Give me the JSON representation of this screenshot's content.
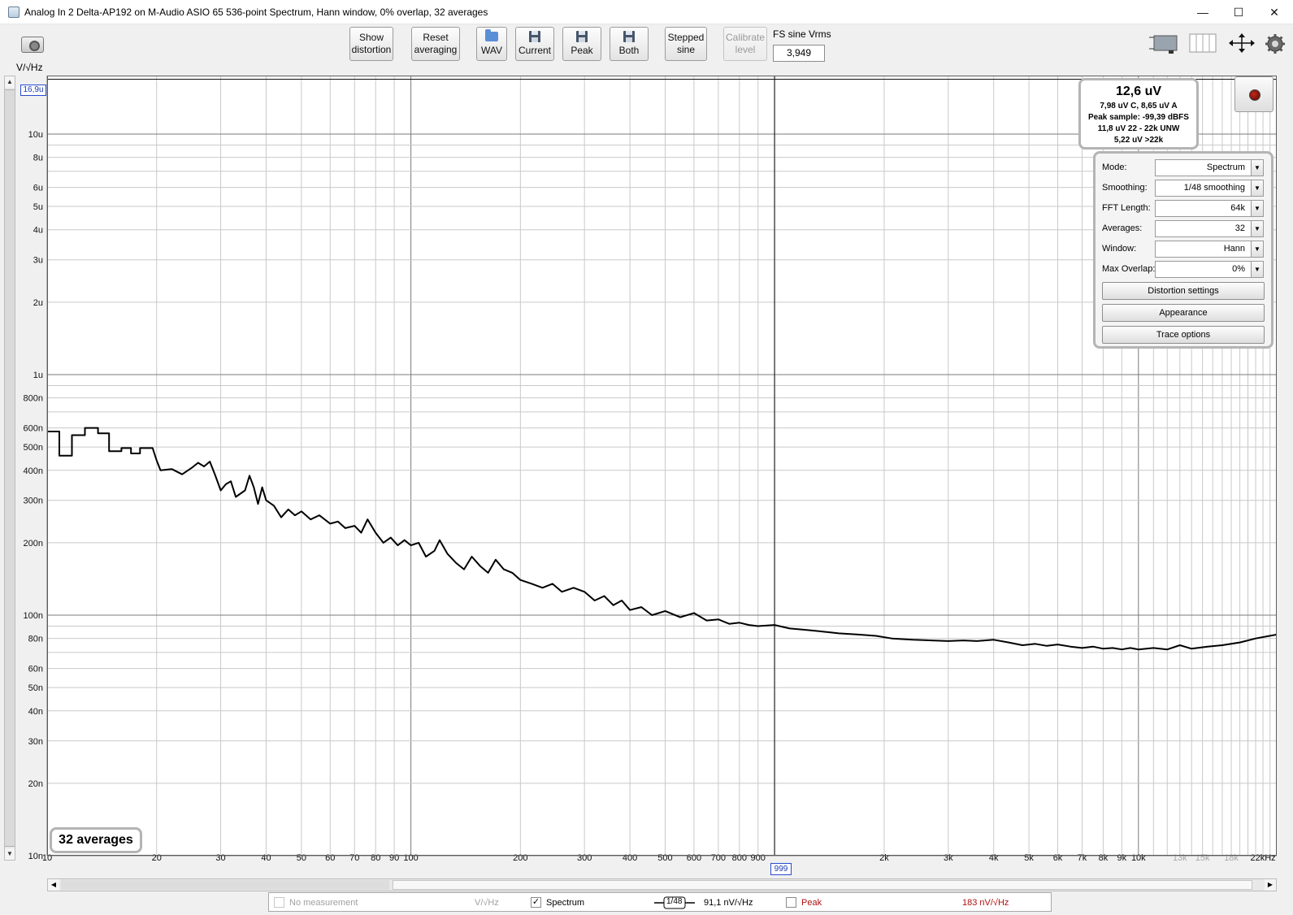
{
  "window": {
    "title": "Analog In 2 Delta-AP192 on M-Audio ASIO 65 536-point Spectrum, Hann window, 0% overlap, 32 averages",
    "minimize_glyph": "—",
    "maximize_glyph": "☐",
    "close_glyph": "✕"
  },
  "toolbar": {
    "show_distortion": [
      "Show",
      "distortion"
    ],
    "reset_averaging": [
      "Reset",
      "averaging"
    ],
    "wav": "WAV",
    "current": "Current",
    "peak": "Peak",
    "both": "Both",
    "stepped_sine": [
      "Stepped",
      "sine"
    ],
    "calibrate_level": [
      "Calibrate",
      "level"
    ],
    "fs_sine_label": "FS sine Vrms",
    "fs_sine_value": "3,949"
  },
  "y_unit_label": "V/√Hz",
  "y_marker": "16,9u",
  "x_marker": "999",
  "averages_badge": "32 averages",
  "info": {
    "main": "12,6 uV",
    "line1": "7,98 uV C, 8,65 uV A",
    "line2": "Peak sample: -99,39 dBFS",
    "line3": "11,8 uV 22 - 22k UNW",
    "line4": "5,22 uV >22k"
  },
  "controls": {
    "mode": {
      "label": "Mode:",
      "value": "Spectrum"
    },
    "smoothing": {
      "label": "Smoothing:",
      "value": "1/48 smoothing"
    },
    "fft_length": {
      "label": "FFT Length:",
      "value": "64k"
    },
    "averages": {
      "label": "Averages:",
      "value": "32"
    },
    "window": {
      "label": "Window:",
      "value": "Hann"
    },
    "max_overlap": {
      "label": "Max Overlap:",
      "value": "0%"
    },
    "distortion_settings": "Distortion settings",
    "appearance": "Appearance",
    "trace_options": "Trace options"
  },
  "legend": {
    "no_measurement": "No measurement",
    "no_measurement_unit": "V/√Hz",
    "spectrum": "Spectrum",
    "spectrum_smoothing": "1/48",
    "spectrum_value": "91,1 nV/√Hz",
    "peak": "Peak",
    "peak_value": "183 nV/√Hz",
    "spectrum_checked_glyph": "✓"
  },
  "icons": {
    "camera": "camera-icon",
    "graph_layout": "graph-layout-icon",
    "columns": "columns-icon",
    "move": "move-arrows-icon",
    "settings": "gear-icon",
    "record": "record-icon"
  },
  "chart_data": {
    "type": "line",
    "xlabel": "",
    "ylabel": "V/√Hz",
    "xscale": "log",
    "yscale": "log",
    "xlim": [
      10,
      24000
    ],
    "ylim": [
      1e-08,
      1.75e-05
    ],
    "x_ticks": [
      {
        "v": 10,
        "label": "10"
      },
      {
        "v": 20,
        "label": "20"
      },
      {
        "v": 30,
        "label": "30"
      },
      {
        "v": 40,
        "label": "40"
      },
      {
        "v": 50,
        "label": "50"
      },
      {
        "v": 60,
        "label": "60"
      },
      {
        "v": 70,
        "label": "70"
      },
      {
        "v": 80,
        "label": "80"
      },
      {
        "v": 90,
        "label": "90"
      },
      {
        "v": 100,
        "label": "100"
      },
      {
        "v": 200,
        "label": "200"
      },
      {
        "v": 300,
        "label": "300"
      },
      {
        "v": 400,
        "label": "400"
      },
      {
        "v": 500,
        "label": "500"
      },
      {
        "v": 600,
        "label": "600"
      },
      {
        "v": 700,
        "label": "700"
      },
      {
        "v": 800,
        "label": "800"
      },
      {
        "v": 900,
        "label": "900"
      },
      {
        "v": 2000,
        "label": "2k"
      },
      {
        "v": 3000,
        "label": "3k"
      },
      {
        "v": 4000,
        "label": "4k"
      },
      {
        "v": 5000,
        "label": "5k"
      },
      {
        "v": 6000,
        "label": "6k"
      },
      {
        "v": 7000,
        "label": "7k"
      },
      {
        "v": 8000,
        "label": "8k"
      },
      {
        "v": 9000,
        "label": "9k"
      },
      {
        "v": 10000,
        "label": "10k"
      },
      {
        "v": 13000,
        "label": "13k",
        "dim": true
      },
      {
        "v": 15000,
        "label": "15k",
        "dim": true
      },
      {
        "v": 18000,
        "label": "18k",
        "dim": true
      },
      {
        "v": 22000,
        "label": "22kHz"
      }
    ],
    "y_ticks": [
      {
        "v": 1e-05,
        "label": "10u"
      },
      {
        "v": 8e-06,
        "label": "8u"
      },
      {
        "v": 6e-06,
        "label": "6u"
      },
      {
        "v": 5e-06,
        "label": "5u"
      },
      {
        "v": 4e-06,
        "label": "4u"
      },
      {
        "v": 3e-06,
        "label": "3u"
      },
      {
        "v": 2e-06,
        "label": "2u"
      },
      {
        "v": 1e-06,
        "label": "1u"
      },
      {
        "v": 8e-07,
        "label": "800n"
      },
      {
        "v": 6e-07,
        "label": "600n"
      },
      {
        "v": 5e-07,
        "label": "500n"
      },
      {
        "v": 4e-07,
        "label": "400n"
      },
      {
        "v": 3e-07,
        "label": "300n"
      },
      {
        "v": 2e-07,
        "label": "200n"
      },
      {
        "v": 1e-07,
        "label": "100n"
      },
      {
        "v": 8e-08,
        "label": "80n"
      },
      {
        "v": 6e-08,
        "label": "60n"
      },
      {
        "v": 5e-08,
        "label": "50n"
      },
      {
        "v": 4e-08,
        "label": "40n"
      },
      {
        "v": 3e-08,
        "label": "30n"
      },
      {
        "v": 2e-08,
        "label": "20n"
      },
      {
        "v": 1e-08,
        "label": "10n"
      }
    ],
    "cursor": {
      "x": 999,
      "y": 1.69e-05
    },
    "series": [
      {
        "color": "#000000",
        "points": [
          [
            10,
            5.8e-07
          ],
          [
            10.8,
            5.8e-07
          ],
          [
            10.8,
            4.6e-07
          ],
          [
            11.7,
            4.6e-07
          ],
          [
            11.7,
            5.6e-07
          ],
          [
            12.7,
            5.6e-07
          ],
          [
            12.7,
            6e-07
          ],
          [
            13.8,
            6e-07
          ],
          [
            13.8,
            5.7e-07
          ],
          [
            14.8,
            5.7e-07
          ],
          [
            14.8,
            4.8e-07
          ],
          [
            16,
            4.8e-07
          ],
          [
            16,
            4.95e-07
          ],
          [
            17,
            4.95e-07
          ],
          [
            17,
            4.7e-07
          ],
          [
            18,
            4.7e-07
          ],
          [
            18,
            4.95e-07
          ],
          [
            19.5,
            4.95e-07
          ],
          [
            20,
            4.4e-07
          ],
          [
            20.5,
            4e-07
          ],
          [
            22,
            4.05e-07
          ],
          [
            23.5,
            3.85e-07
          ],
          [
            25,
            4.1e-07
          ],
          [
            26,
            4.3e-07
          ],
          [
            27,
            4.15e-07
          ],
          [
            28,
            4.35e-07
          ],
          [
            29,
            3.8e-07
          ],
          [
            30,
            3.3e-07
          ],
          [
            31,
            3.5e-07
          ],
          [
            32,
            3.6e-07
          ],
          [
            33,
            3.1e-07
          ],
          [
            35,
            3.3e-07
          ],
          [
            36,
            3.8e-07
          ],
          [
            37,
            3.4e-07
          ],
          [
            38,
            2.9e-07
          ],
          [
            39,
            3.4e-07
          ],
          [
            40,
            3e-07
          ],
          [
            42,
            2.85e-07
          ],
          [
            44,
            2.55e-07
          ],
          [
            46,
            2.75e-07
          ],
          [
            48,
            2.6e-07
          ],
          [
            50,
            2.7e-07
          ],
          [
            53,
            2.5e-07
          ],
          [
            56,
            2.6e-07
          ],
          [
            60,
            2.4e-07
          ],
          [
            63,
            2.45e-07
          ],
          [
            66,
            2.3e-07
          ],
          [
            70,
            2.35e-07
          ],
          [
            73,
            2.2e-07
          ],
          [
            76,
            2.5e-07
          ],
          [
            80,
            2.2e-07
          ],
          [
            84,
            2e-07
          ],
          [
            88,
            2.1e-07
          ],
          [
            92,
            1.95e-07
          ],
          [
            96,
            2.05e-07
          ],
          [
            100,
            1.95e-07
          ],
          [
            105,
            2e-07
          ],
          [
            110,
            1.75e-07
          ],
          [
            116,
            1.85e-07
          ],
          [
            120,
            2.05e-07
          ],
          [
            126,
            1.8e-07
          ],
          [
            133,
            1.65e-07
          ],
          [
            140,
            1.55e-07
          ],
          [
            147,
            1.75e-07
          ],
          [
            155,
            1.6e-07
          ],
          [
            163,
            1.5e-07
          ],
          [
            171,
            1.7e-07
          ],
          [
            180,
            1.55e-07
          ],
          [
            190,
            1.5e-07
          ],
          [
            200,
            1.4e-07
          ],
          [
            215,
            1.35e-07
          ],
          [
            230,
            1.3e-07
          ],
          [
            245,
            1.35e-07
          ],
          [
            260,
            1.25e-07
          ],
          [
            280,
            1.3e-07
          ],
          [
            300,
            1.25e-07
          ],
          [
            320,
            1.15e-07
          ],
          [
            340,
            1.2e-07
          ],
          [
            360,
            1.1e-07
          ],
          [
            380,
            1.15e-07
          ],
          [
            400,
            1.05e-07
          ],
          [
            430,
            1.08e-07
          ],
          [
            460,
            1e-07
          ],
          [
            500,
            1.04e-07
          ],
          [
            550,
            9.8e-08
          ],
          [
            600,
            1.02e-07
          ],
          [
            650,
            9.5e-08
          ],
          [
            700,
            9.6e-08
          ],
          [
            750,
            9.2e-08
          ],
          [
            800,
            9.3e-08
          ],
          [
            850,
            9.1e-08
          ],
          [
            900,
            9e-08
          ],
          [
            999,
            9.1e-08
          ],
          [
            1100,
            8.8e-08
          ],
          [
            1200,
            8.7e-08
          ],
          [
            1300,
            8.6e-08
          ],
          [
            1400,
            8.5e-08
          ],
          [
            1500,
            8.4e-08
          ],
          [
            1700,
            8.3e-08
          ],
          [
            1900,
            8.2e-08
          ],
          [
            2100,
            8e-08
          ],
          [
            2400,
            7.9e-08
          ],
          [
            2700,
            7.85e-08
          ],
          [
            3000,
            7.8e-08
          ],
          [
            3300,
            7.85e-08
          ],
          [
            3600,
            7.8e-08
          ],
          [
            4000,
            7.9e-08
          ],
          [
            4400,
            7.7e-08
          ],
          [
            4800,
            7.5e-08
          ],
          [
            5200,
            7.6e-08
          ],
          [
            5600,
            7.45e-08
          ],
          [
            6000,
            7.55e-08
          ],
          [
            6500,
            7.4e-08
          ],
          [
            7000,
            7.3e-08
          ],
          [
            7500,
            7.4e-08
          ],
          [
            8000,
            7.25e-08
          ],
          [
            8500,
            7.3e-08
          ],
          [
            9000,
            7.2e-08
          ],
          [
            9500,
            7.3e-08
          ],
          [
            10000,
            7.2e-08
          ],
          [
            11000,
            7.3e-08
          ],
          [
            12000,
            7.2e-08
          ],
          [
            13000,
            7.5e-08
          ],
          [
            14000,
            7.25e-08
          ],
          [
            15500,
            7.4e-08
          ],
          [
            17000,
            7.5e-08
          ],
          [
            19000,
            7.7e-08
          ],
          [
            21000,
            8e-08
          ],
          [
            24000,
            8.3e-08
          ]
        ]
      }
    ]
  }
}
